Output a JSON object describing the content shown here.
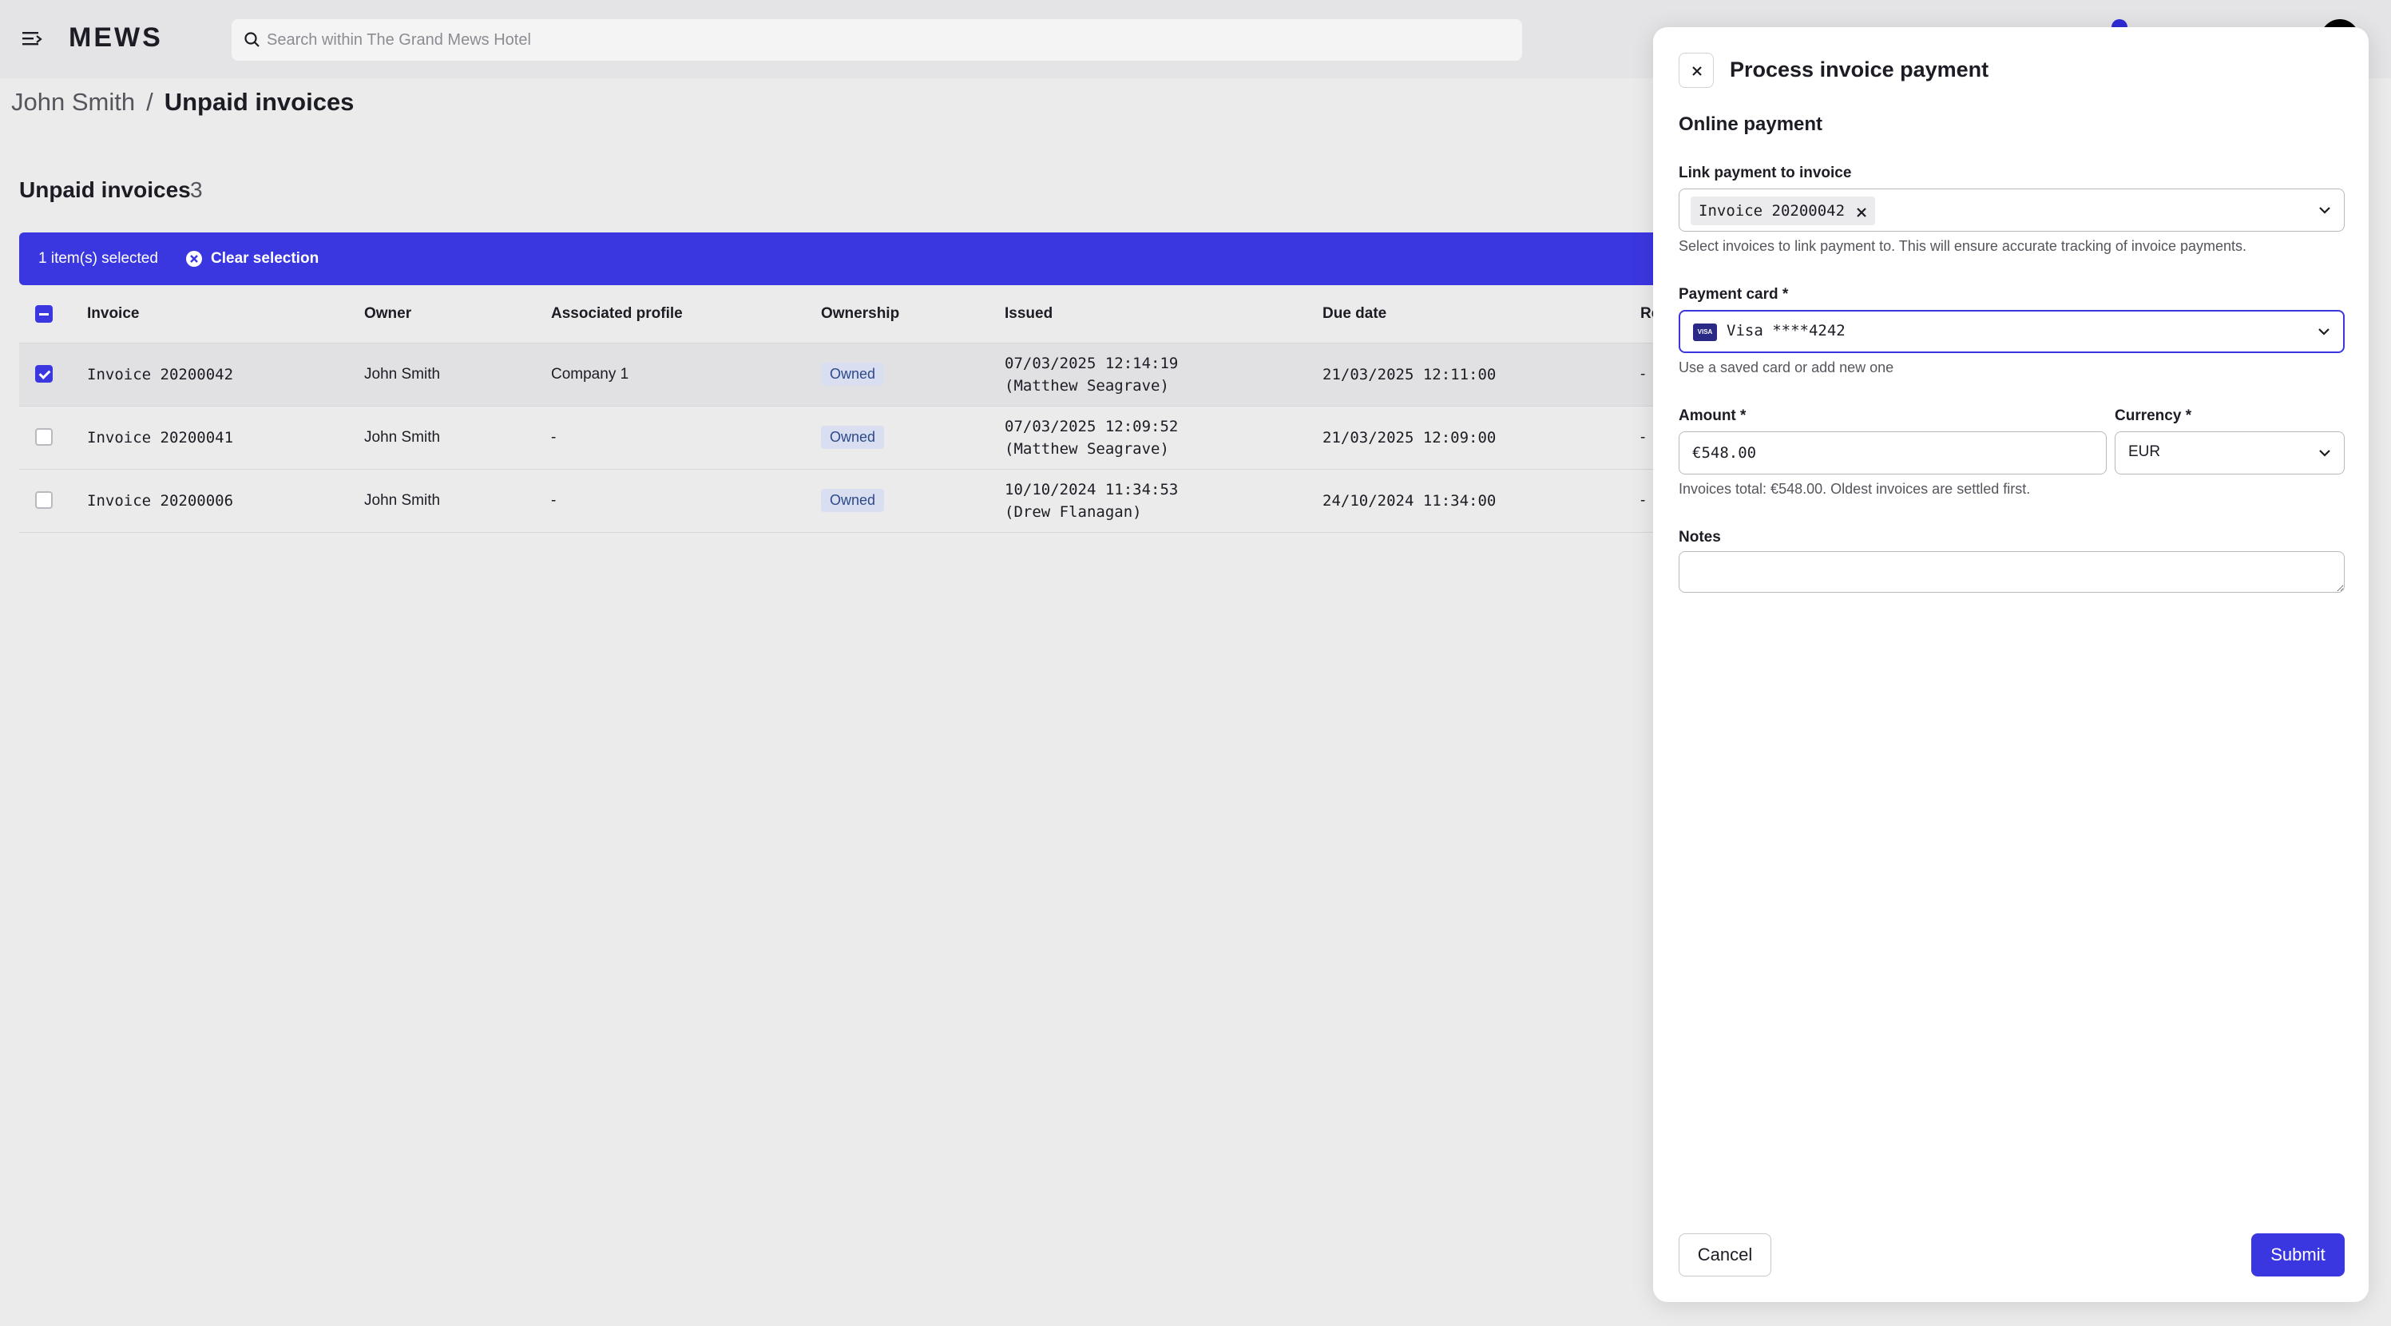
{
  "app": {
    "logo": "MEWS"
  },
  "search": {
    "placeholder": "Search within The Grand Mews Hotel"
  },
  "breadcrumb": {
    "parent": "John Smith",
    "separator": "/",
    "current": "Unpaid invoices"
  },
  "section": {
    "title": "Unpaid invoices",
    "count": "3"
  },
  "selection_bar": {
    "text": "1 item(s) selected",
    "clear_label": "Clear selection"
  },
  "table": {
    "columns": [
      "Invoice",
      "Owner",
      "Associated profile",
      "Ownership",
      "Issued",
      "Due date",
      "Re"
    ],
    "rows": [
      {
        "invoice": "Invoice 20200042",
        "owner": "John Smith",
        "profile": "Company 1",
        "ownership": "Owned",
        "issued_date": "07/03/2025 12:14:19",
        "issued_by": "(Matthew Seagrave)",
        "due": "21/03/2025 12:11:00",
        "re": "-",
        "selected": true
      },
      {
        "invoice": "Invoice 20200041",
        "owner": "John Smith",
        "profile": "-",
        "ownership": "Owned",
        "issued_date": "07/03/2025 12:09:52",
        "issued_by": "(Matthew Seagrave)",
        "due": "21/03/2025 12:09:00",
        "re": "-",
        "selected": false
      },
      {
        "invoice": "Invoice 20200006",
        "owner": "John Smith",
        "profile": "-",
        "ownership": "Owned",
        "issued_date": "10/10/2024 11:34:53",
        "issued_by": "(Drew Flanagan)",
        "due": "24/10/2024 11:34:00",
        "re": "-",
        "selected": false
      }
    ]
  },
  "panel": {
    "title": "Process invoice payment",
    "subtitle": "Online payment",
    "link_label": "Link payment to invoice",
    "link_chip": "Invoice 20200042",
    "link_help": "Select invoices to link payment to. This will ensure accurate tracking of invoice payments.",
    "card_label": "Payment card *",
    "card_brand": "VISA",
    "card_value": "Visa ****4242",
    "card_help": "Use a saved card or add new one",
    "amount_label": "Amount *",
    "amount_value": "€548.00",
    "currency_label": "Currency *",
    "currency_value": "EUR",
    "amount_help": "Invoices total: €548.00. Oldest invoices are settled first.",
    "notes_label": "Notes",
    "cancel_label": "Cancel",
    "submit_label": "Submit"
  },
  "colors": {
    "accent": "#3b37e0",
    "badge_bg": "#d9dff0",
    "badge_text": "#2c4a8a"
  }
}
